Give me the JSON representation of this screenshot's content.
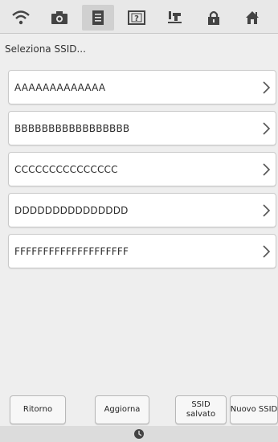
{
  "header": {
    "tabs": [
      {
        "icon": "wifi-icon",
        "active": false
      },
      {
        "icon": "camera-icon",
        "active": false
      },
      {
        "icon": "document-icon",
        "active": true
      },
      {
        "icon": "help-icon",
        "active": false
      },
      {
        "icon": "machine-icon",
        "active": false
      },
      {
        "icon": "lock-icon",
        "active": false
      },
      {
        "icon": "home-icon",
        "active": false
      }
    ]
  },
  "page": {
    "title": "Seleziona SSID..."
  },
  "ssid_list": [
    {
      "label": "AAAAAAAAAAAAA"
    },
    {
      "label": "BBBBBBBBBBBBBBBBB"
    },
    {
      "label": "CCCCCCCCCCCCCCC"
    },
    {
      "label": "DDDDDDDDDDDDDDD"
    },
    {
      "label": "FFFFFFFFFFFFFFFFFFFF"
    }
  ],
  "footer": {
    "back_label": "Ritorno",
    "refresh_label": "Aggiorna",
    "saved_ssid_label": "SSID salvato",
    "new_ssid_label": "Nuovo SSID"
  },
  "statusbar": {
    "icon": "clock-icon"
  },
  "colors": {
    "background": "#eeeeee",
    "row_background": "#ffffff",
    "active_tab": "#d0d0d0"
  }
}
